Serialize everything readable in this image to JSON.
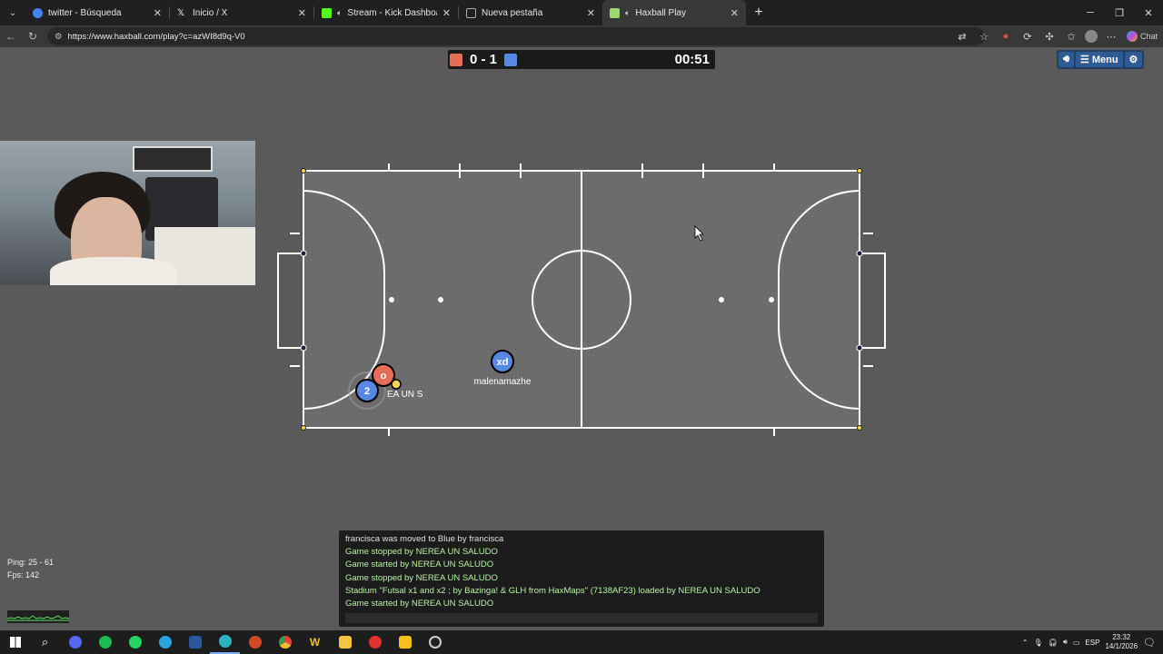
{
  "browser": {
    "tabs": [
      {
        "title": "twitter - Búsqueda",
        "icon": "google-icon",
        "color": "#4285f4",
        "active": false
      },
      {
        "title": "Inicio / X",
        "icon": "x-logo-icon",
        "color": "#ffffff",
        "active": false
      },
      {
        "title": "Stream - Kick Dashboard",
        "icon": "kick-logo-icon",
        "color": "#53fc18",
        "active": false
      },
      {
        "title": "Nueva pestaña",
        "icon": "newtab-icon",
        "color": "#aaaaaa",
        "active": false
      },
      {
        "title": "Haxball Play",
        "icon": "haxball-icon",
        "color": "#9fd86b",
        "active": true
      }
    ],
    "url": "https://www.haxball.com/play?c=azWI8d9q-V0",
    "copilot_label": "Chat"
  },
  "game": {
    "score": "0 - 1",
    "timer": "00:51",
    "red_color": "#e56e56",
    "blue_color": "#5689e5",
    "menu_label": "Menu",
    "players": [
      {
        "team": "red",
        "avatar": "o",
        "name": ""
      },
      {
        "team": "blue",
        "avatar": "2",
        "name": "EA UN S"
      },
      {
        "team": "blue",
        "avatar": "xd",
        "name": "malenamazhe"
      }
    ]
  },
  "chat": {
    "lines": [
      "francisca was moved to Blue by francisca",
      "Game stopped by NEREA UN SALUDO",
      "Game started by NEREA UN SALUDO",
      "Game stopped by NEREA UN SALUDO",
      "Stadium \"Futsal x1 and x2 ; by Bazinga! & GLH from HaxMaps\" (7138AF23) loaded by NEREA UN SALUDO",
      "Game started by NEREA UN SALUDO"
    ]
  },
  "stats": {
    "ping": "Ping: 25 - 61",
    "fps": "Fps: 142"
  },
  "taskbar": {
    "lang": "ESP",
    "time": "23:32",
    "date": "14/1/2026",
    "apps": [
      {
        "name": "start-icon",
        "color": "#ffffff"
      },
      {
        "name": "search-icon",
        "color": "#ffffff"
      },
      {
        "name": "discord-icon",
        "color": "#5865f2"
      },
      {
        "name": "spotify-icon",
        "color": "#1db954"
      },
      {
        "name": "whatsapp-icon",
        "color": "#25d366"
      },
      {
        "name": "telegram-icon",
        "color": "#2aa3df"
      },
      {
        "name": "word-icon",
        "color": "#2b579a"
      },
      {
        "name": "edge-icon",
        "color": "#2bb3c0"
      },
      {
        "name": "powerpoint-icon",
        "color": "#d24726"
      },
      {
        "name": "chrome-icon",
        "color": "#e8453c"
      },
      {
        "name": "winamp-icon",
        "color": "#f0c419"
      },
      {
        "name": "folder-icon",
        "color": "#f5c542"
      },
      {
        "name": "app-red-icon",
        "color": "#e03030"
      },
      {
        "name": "kick-studio-icon",
        "color": "#f2c21b"
      },
      {
        "name": "obs-icon",
        "color": "#cccccc"
      }
    ]
  }
}
